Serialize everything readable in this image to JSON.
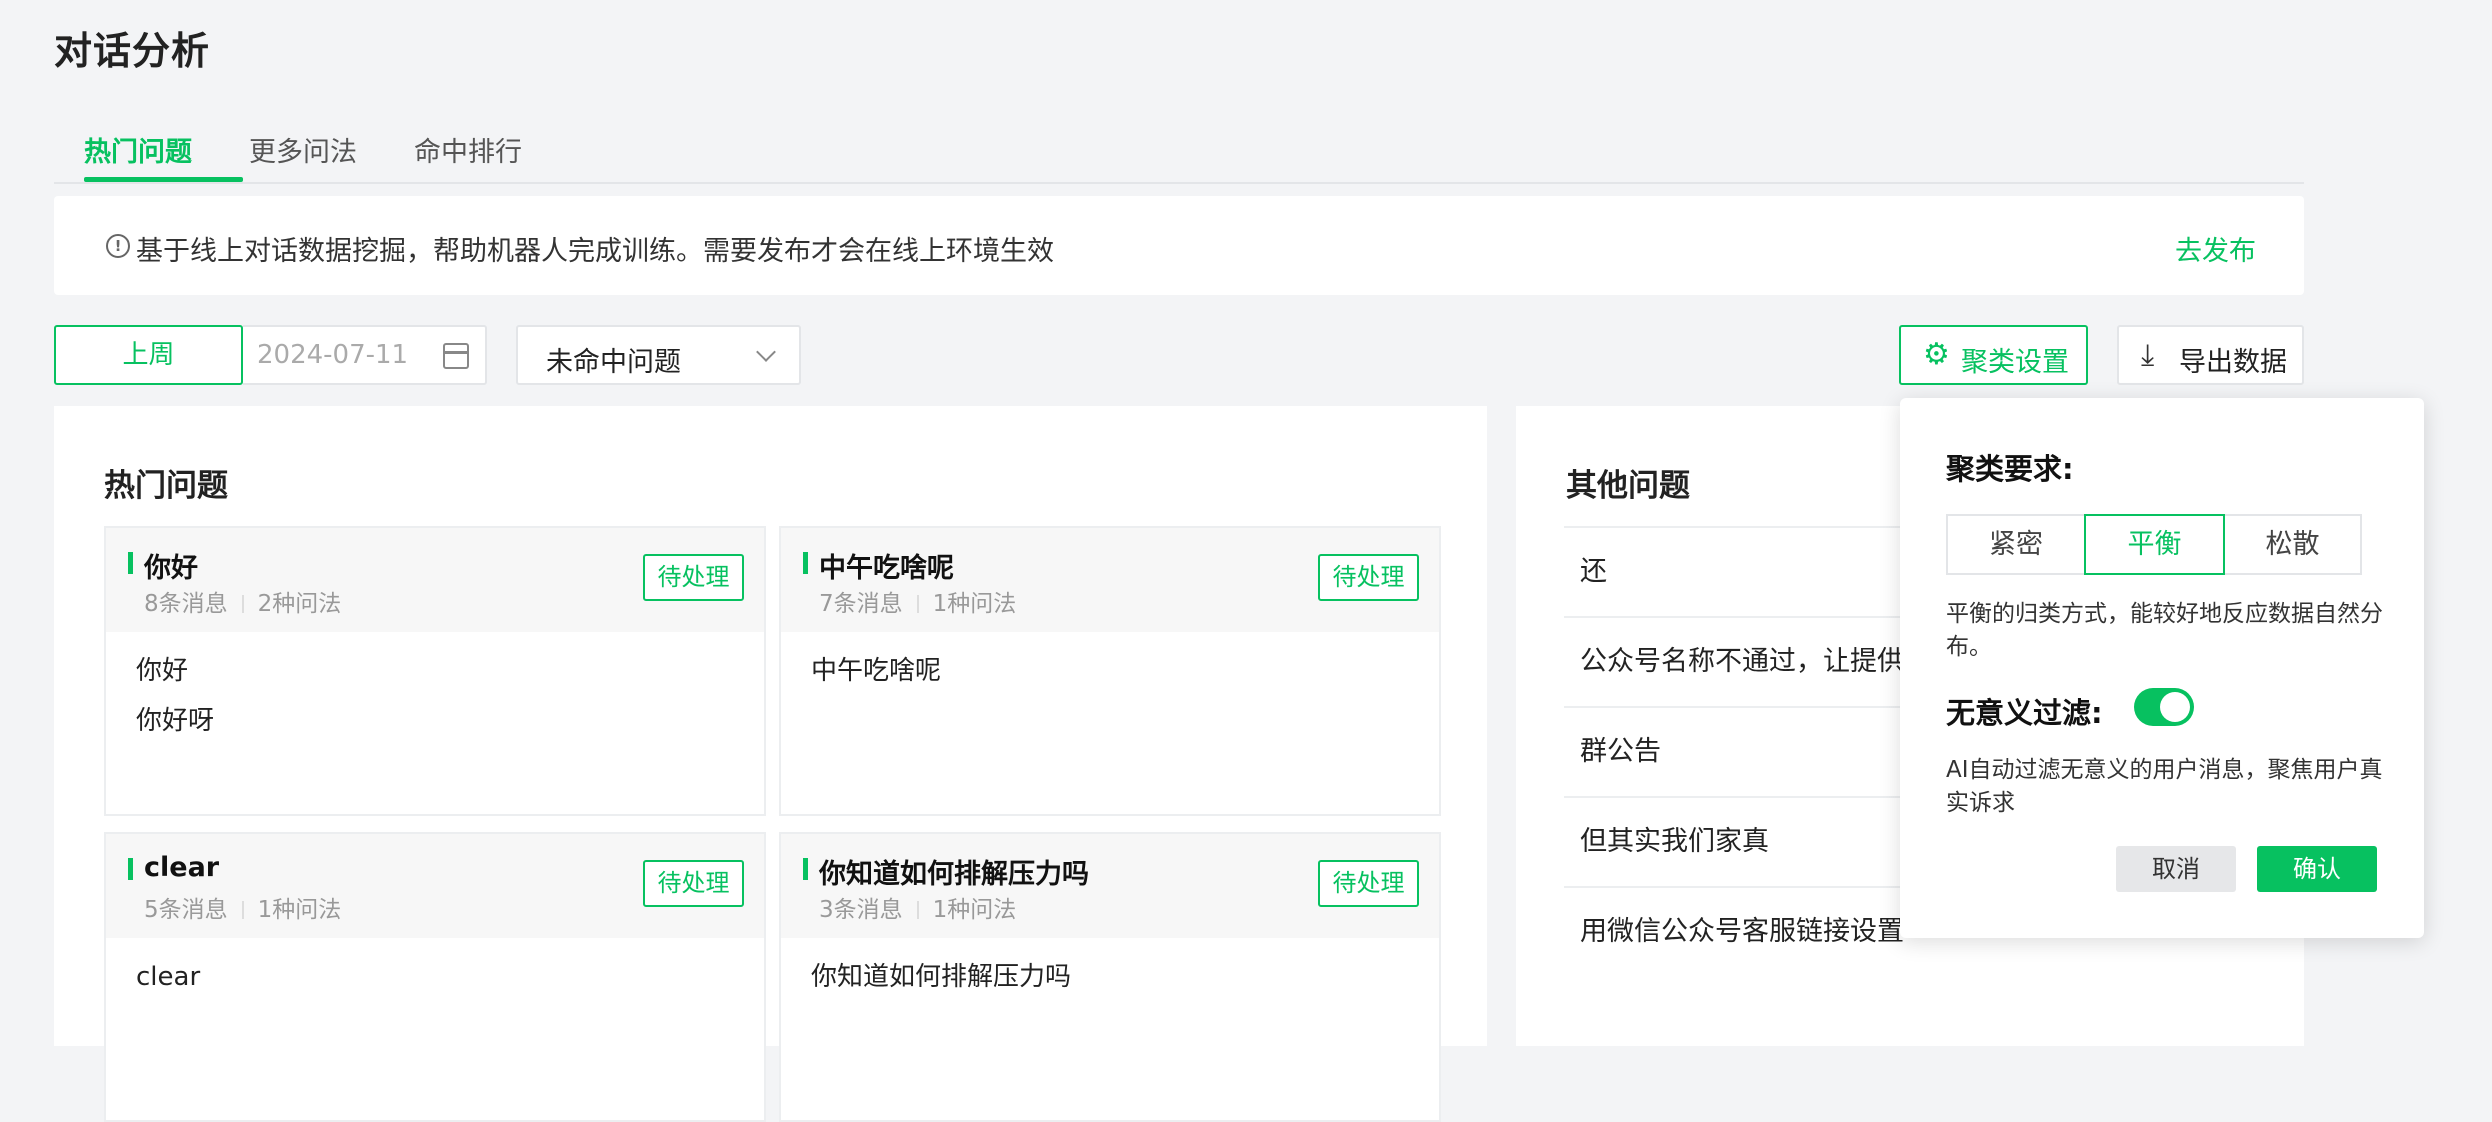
{
  "page_title": "对话分析",
  "tabs": [
    {
      "label": "热门问题",
      "active": true
    },
    {
      "label": "更多问法",
      "active": false
    },
    {
      "label": "命中排行",
      "active": false
    }
  ],
  "notice": {
    "icon": "info-circle-icon",
    "text": "基于线上对话数据挖掘，帮助机器人完成训练。需要发布才会在线上环境生效",
    "link": "去发布"
  },
  "filters": {
    "week_label": "上周",
    "date_value": "2024-07-11",
    "select_value": "未命中问题"
  },
  "toolbar": {
    "cluster_label": "聚类设置",
    "export_label": "导出数据"
  },
  "hot": {
    "title": "热门问题",
    "cards": [
      {
        "title": "你好",
        "messages": "8条消息",
        "variants": "2种问法",
        "status": "待处理",
        "lines": [
          "你好",
          "你好呀"
        ]
      },
      {
        "title": "中午吃啥呢",
        "messages": "7条消息",
        "variants": "1种问法",
        "status": "待处理",
        "lines": [
          "中午吃啥呢"
        ]
      },
      {
        "title": "clear",
        "messages": "5条消息",
        "variants": "1种问法",
        "status": "待处理",
        "lines": [
          "clear"
        ]
      },
      {
        "title": "你知道如何排解压力吗",
        "messages": "3条消息",
        "variants": "1种问法",
        "status": "待处理",
        "lines": [
          "你知道如何排解压力吗"
        ]
      }
    ]
  },
  "other": {
    "title": "其他问题",
    "items": [
      "还",
      "公众号名称不通过，让提供",
      "群公告",
      "但其实我们家真",
      "用微信公众号客服链接设置"
    ]
  },
  "popover": {
    "cluster_label": "聚类要求:",
    "options": [
      "紧密",
      "平衡",
      "松散"
    ],
    "selected": "平衡",
    "cluster_desc": "平衡的归类方式，能较好地反应数据自然分布。",
    "filter_label": "无意义过滤:",
    "filter_on": true,
    "filter_desc": "AI自动过滤无意义的用户消息，聚焦用户真实诉求",
    "cancel": "取消",
    "confirm": "确认"
  },
  "colors": {
    "accent": "#07c160",
    "background": "#f3f4f6"
  }
}
